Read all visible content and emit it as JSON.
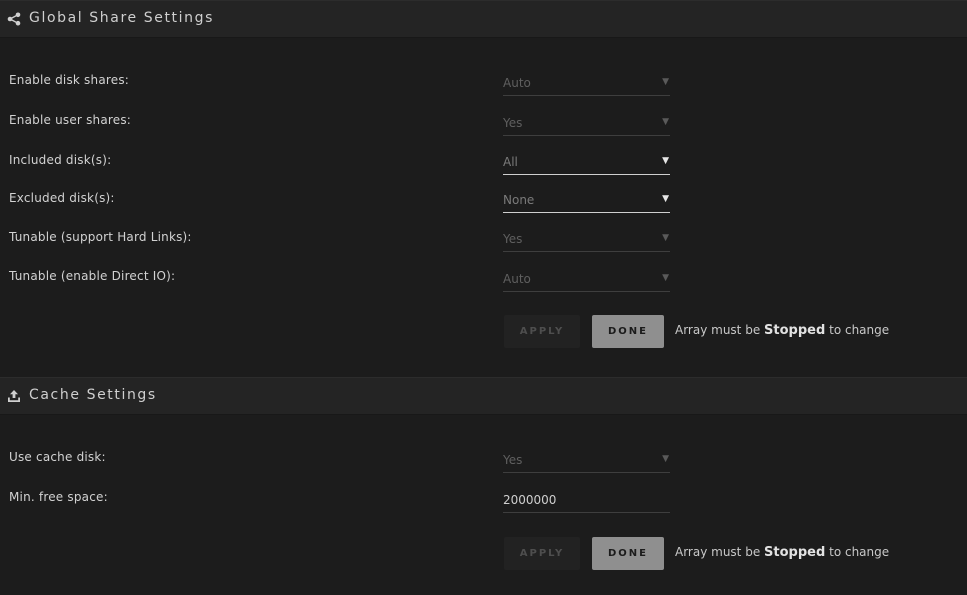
{
  "global_share": {
    "title": "Global Share Settings",
    "icon": "share-icon",
    "rows": [
      {
        "label": "Enable disk shares:",
        "value": "Auto",
        "active": false
      },
      {
        "label": "Enable user shares:",
        "value": "Yes",
        "active": false
      },
      {
        "label": "Included disk(s):",
        "value": "All",
        "active": true
      },
      {
        "label": "Excluded disk(s):",
        "value": "None",
        "active": true
      },
      {
        "label": "Tunable (support Hard Links):",
        "value": "Yes",
        "active": false
      },
      {
        "label": "Tunable (enable Direct IO):",
        "value": "Auto",
        "active": false
      }
    ],
    "apply_label": "APPLY",
    "done_label": "DONE",
    "note_prefix": "Array must be",
    "note_strong": "Stopped",
    "note_suffix": "to change"
  },
  "cache": {
    "title": "Cache Settings",
    "icon": "upload-icon",
    "use_cache_label": "Use cache disk:",
    "use_cache_value": "Yes",
    "min_free_label": "Min. free space:",
    "min_free_value": "2000000",
    "apply_label": "APPLY",
    "done_label": "DONE",
    "note_prefix": "Array must be",
    "note_strong": "Stopped",
    "note_suffix": "to change"
  },
  "colors": {
    "background": "#1c1c1c",
    "header": "#242424",
    "done_button": "#8f8f8f"
  }
}
